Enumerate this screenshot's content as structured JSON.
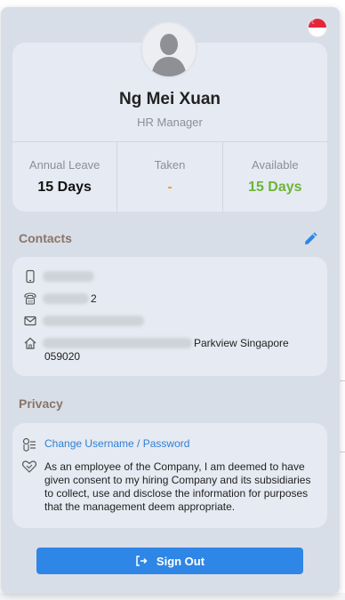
{
  "profile": {
    "name": "Ng Mei Xuan",
    "role": "HR Manager",
    "country_flag": "singapore-flag-icon"
  },
  "leave": {
    "annual_label": "Annual Leave",
    "annual_value": "15 Days",
    "taken_label": "Taken",
    "taken_value": "-",
    "available_label": "Available",
    "available_value": "15 Days"
  },
  "contacts": {
    "title": "Contacts",
    "phone_suffix": "",
    "tel_suffix": "2",
    "address_line1": "Parkview Singapore",
    "address_line2": "059020"
  },
  "privacy": {
    "title": "Privacy",
    "change_link": "Change Username / Password",
    "consent_text": "As an employee of the Company, I am deemed to have given consent to my hiring Company and its subsidiaries to collect, use and disclose the information for purposes that the management deem appropriate."
  },
  "actions": {
    "sign_out": "Sign Out"
  },
  "colors": {
    "accent": "#2e86e6",
    "available": "#6bb536",
    "taken": "#f0a030",
    "section_title": "#8a7566"
  }
}
